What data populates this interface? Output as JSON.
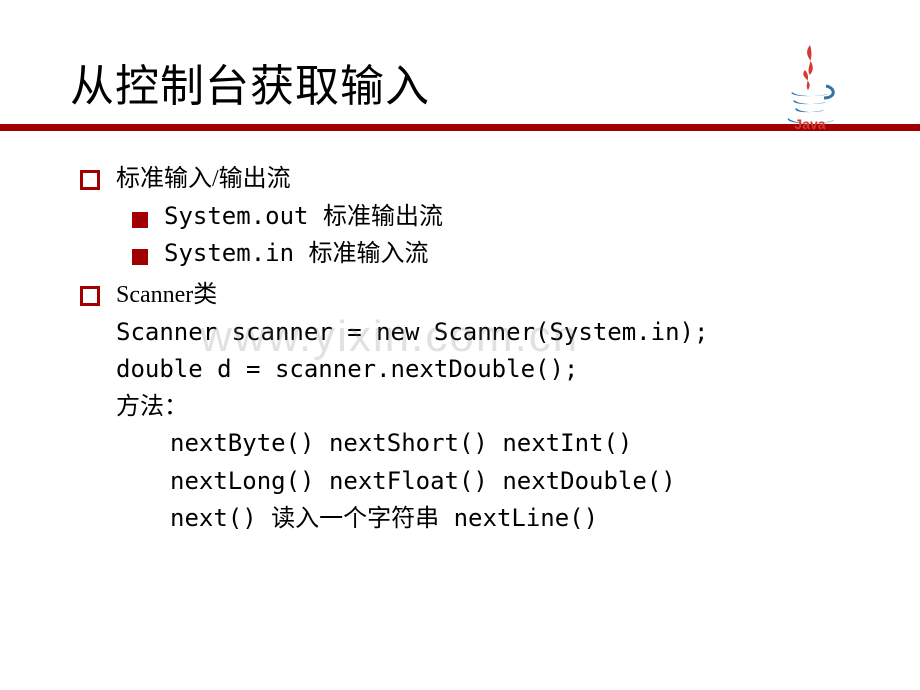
{
  "header": {
    "title": "从控制台获取输入",
    "logo_name": "java-logo"
  },
  "watermark": "www.yixin.com.cn",
  "bullets": {
    "b1": "标准输入/输出流",
    "b1_1": "System.out 标准输出流",
    "b1_2": "System.in  标准输入流",
    "b2": "Scanner类"
  },
  "code": {
    "l1": "Scanner scanner = new Scanner(System.in);",
    "l2": "double d = scanner.nextDouble();",
    "l3": "方法：",
    "l4": "nextByte() nextShort() nextInt()",
    "l5": "nextLong() nextFloat() nextDouble()",
    "l6": "next() 读入一个字符串 nextLine()"
  }
}
